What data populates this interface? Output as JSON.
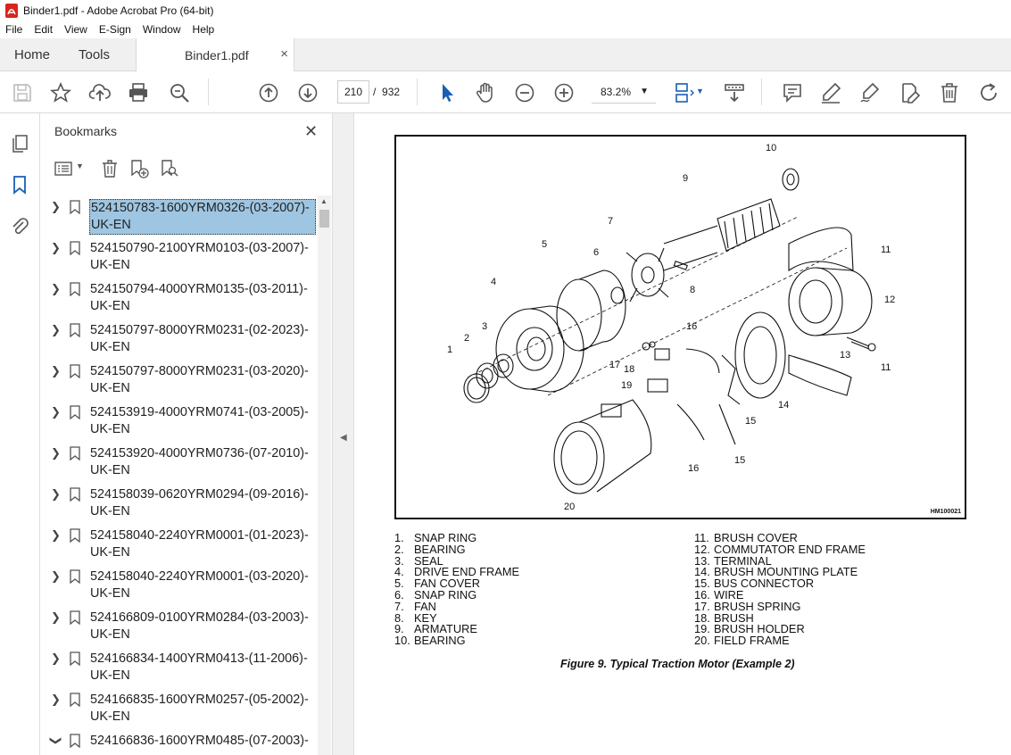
{
  "window": {
    "title": "Binder1.pdf - Adobe Acrobat Pro (64-bit)"
  },
  "menu": [
    "File",
    "Edit",
    "View",
    "E-Sign",
    "Window",
    "Help"
  ],
  "tabs": {
    "home": "Home",
    "tools": "Tools",
    "document": "Binder1.pdf",
    "close": "×"
  },
  "toolbar": {
    "page_current": "210",
    "page_sep": "/",
    "page_total": "932",
    "zoom": "83.2%"
  },
  "bookmarks": {
    "title": "Bookmarks",
    "items": [
      {
        "label": "524150783-1600YRM0326-(03-2007)-UK-EN",
        "selected": true
      },
      {
        "label": "524150790-2100YRM0103-(03-2007)-UK-EN"
      },
      {
        "label": "524150794-4000YRM0135-(03-2011)-UK-EN"
      },
      {
        "label": "524150797-8000YRM0231-(02-2023)-UK-EN"
      },
      {
        "label": "524150797-8000YRM0231-(03-2020)-UK-EN"
      },
      {
        "label": "524153919-4000YRM0741-(03-2005)-UK-EN"
      },
      {
        "label": "524153920-4000YRM0736-(07-2010)-UK-EN"
      },
      {
        "label": "524158039-0620YRM0294-(09-2016)-UK-EN"
      },
      {
        "label": "524158040-2240YRM0001-(01-2023)-UK-EN"
      },
      {
        "label": "524158040-2240YRM0001-(03-2020)-UK-EN"
      },
      {
        "label": "524166809-0100YRM0284-(03-2003)-UK-EN"
      },
      {
        "label": "524166834-1400YRM0413-(11-2006)-UK-EN"
      },
      {
        "label": "524166835-1600YRM0257-(05-2002)-UK-EN"
      },
      {
        "label": "524166836-1600YRM0485-(07-2003)-",
        "expanded": true
      }
    ]
  },
  "figure": {
    "code": "HM100021",
    "callouts": [
      "1",
      "2",
      "3",
      "4",
      "5",
      "6",
      "7",
      "8",
      "9",
      "10",
      "11",
      "11",
      "12",
      "13",
      "14",
      "15",
      "15",
      "16",
      "16",
      "17",
      "18",
      "19",
      "20"
    ],
    "legend_left": [
      {
        "num": "1.",
        "text": "SNAP RING"
      },
      {
        "num": "2.",
        "text": "BEARING"
      },
      {
        "num": "3.",
        "text": "SEAL"
      },
      {
        "num": "4.",
        "text": "DRIVE END FRAME"
      },
      {
        "num": "5.",
        "text": "FAN COVER"
      },
      {
        "num": "6.",
        "text": "SNAP RING"
      },
      {
        "num": "7.",
        "text": "FAN"
      },
      {
        "num": "8.",
        "text": "KEY"
      },
      {
        "num": "9.",
        "text": "ARMATURE"
      },
      {
        "num": "10.",
        "text": "BEARING"
      }
    ],
    "legend_right": [
      {
        "num": "11.",
        "text": "BRUSH COVER"
      },
      {
        "num": "12.",
        "text": "COMMUTATOR END FRAME"
      },
      {
        "num": "13.",
        "text": "TERMINAL"
      },
      {
        "num": "14.",
        "text": "BRUSH MOUNTING PLATE"
      },
      {
        "num": "15.",
        "text": "BUS CONNECTOR"
      },
      {
        "num": "16.",
        "text": "WIRE"
      },
      {
        "num": "17.",
        "text": "BRUSH SPRING"
      },
      {
        "num": "18.",
        "text": "BRUSH"
      },
      {
        "num": "19.",
        "text": "BRUSH HOLDER"
      },
      {
        "num": "20.",
        "text": "FIELD FRAME"
      }
    ],
    "caption": "Figure 9. Typical Traction Motor (Example 2)"
  }
}
